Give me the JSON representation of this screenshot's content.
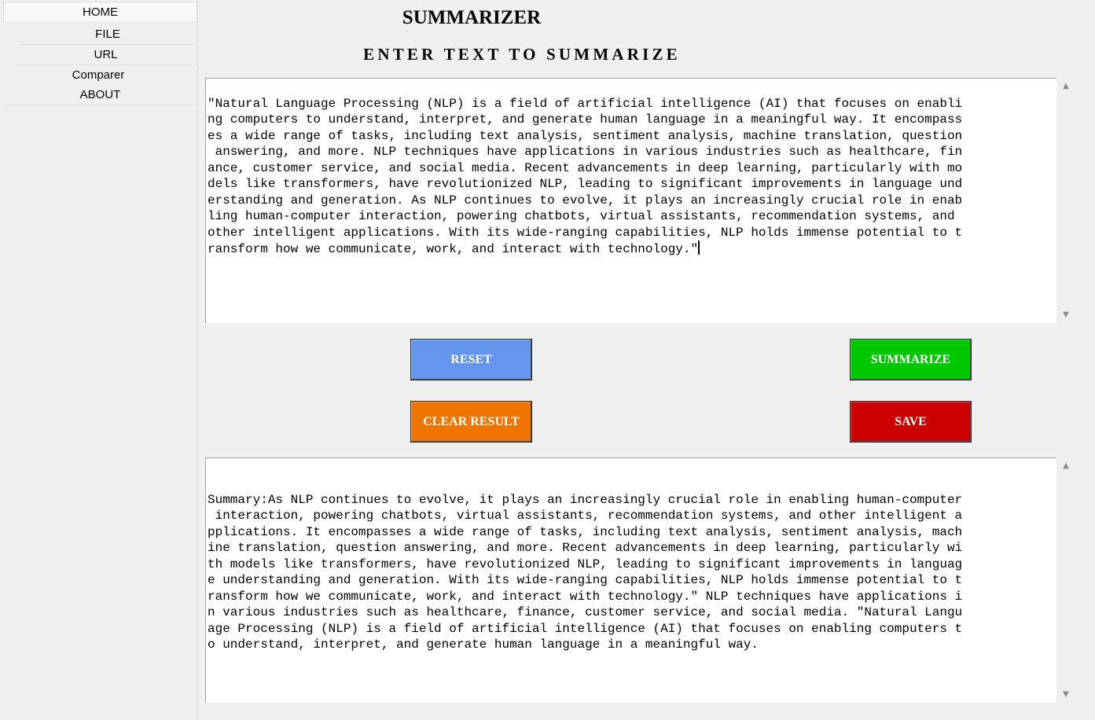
{
  "sidebar": {
    "tabs": [
      {
        "label": "HOME",
        "active": true
      },
      {
        "label": "FILE",
        "active": false
      },
      {
        "label": "URL",
        "active": false
      },
      {
        "label": "Comparer",
        "active": false
      },
      {
        "label": "ABOUT",
        "active": false
      }
    ]
  },
  "header": {
    "title": "SUMMARIZER",
    "subtitle": "ENTER TEXT TO SUMMARIZE"
  },
  "input": {
    "lines": [
      "\"Natural Language Processing (NLP) is a field of artificial intelligence (AI) that focuses on enabli",
      "ng computers to understand, interpret, and generate human language in a meaningful way. It encompass",
      "es a wide range of tasks, including text analysis, sentiment analysis, machine translation, question",
      " answering, and more. NLP techniques have applications in various industries such as healthcare, fin",
      "ance, customer service, and social media. Recent advancements in deep learning, particularly with mo",
      "dels like transformers, have revolutionized NLP, leading to significant improvements in language und",
      "erstanding and generation. As NLP continues to evolve, it plays an increasingly crucial role in enab",
      "ling human-computer interaction, powering chatbots, virtual assistants, recommendation systems, and ",
      "other intelligent applications. With its wide-ranging capabilities, NLP holds immense potential to t",
      "ransform how we communicate, work, and interact with technology.\""
    ]
  },
  "buttons": {
    "reset": {
      "label": "RESET",
      "color": "#6495ed"
    },
    "summarize": {
      "label": "SUMMARIZE",
      "color": "#00c800"
    },
    "clear": {
      "label": "CLEAR RESULT",
      "color": "#ee7600"
    },
    "save": {
      "label": "SAVE",
      "color": "#cc0000"
    }
  },
  "output": {
    "lines": [
      "Summary:As NLP continues to evolve, it plays an increasingly crucial role in enabling human-computer",
      " interaction, powering chatbots, virtual assistants, recommendation systems, and other intelligent a",
      "pplications. It encompasses a wide range of tasks, including text analysis, sentiment analysis, mach",
      "ine translation, question answering, and more. Recent advancements in deep learning, particularly wi",
      "th models like transformers, have revolutionized NLP, leading to significant improvements in languag",
      "e understanding and generation. With its wide-ranging capabilities, NLP holds immense potential to t",
      "ransform how we communicate, work, and interact with technology.\" NLP techniques have applications i",
      "n various industries such as healthcare, finance, customer service, and social media. \"Natural Langu",
      "age Processing (NLP) is a field of artificial intelligence (AI) that focuses on enabling computers t",
      "o understand, interpret, and generate human language in a meaningful way."
    ]
  },
  "icons": {
    "scroll_up": "triangle-up-icon",
    "scroll_down": "triangle-down-icon"
  }
}
